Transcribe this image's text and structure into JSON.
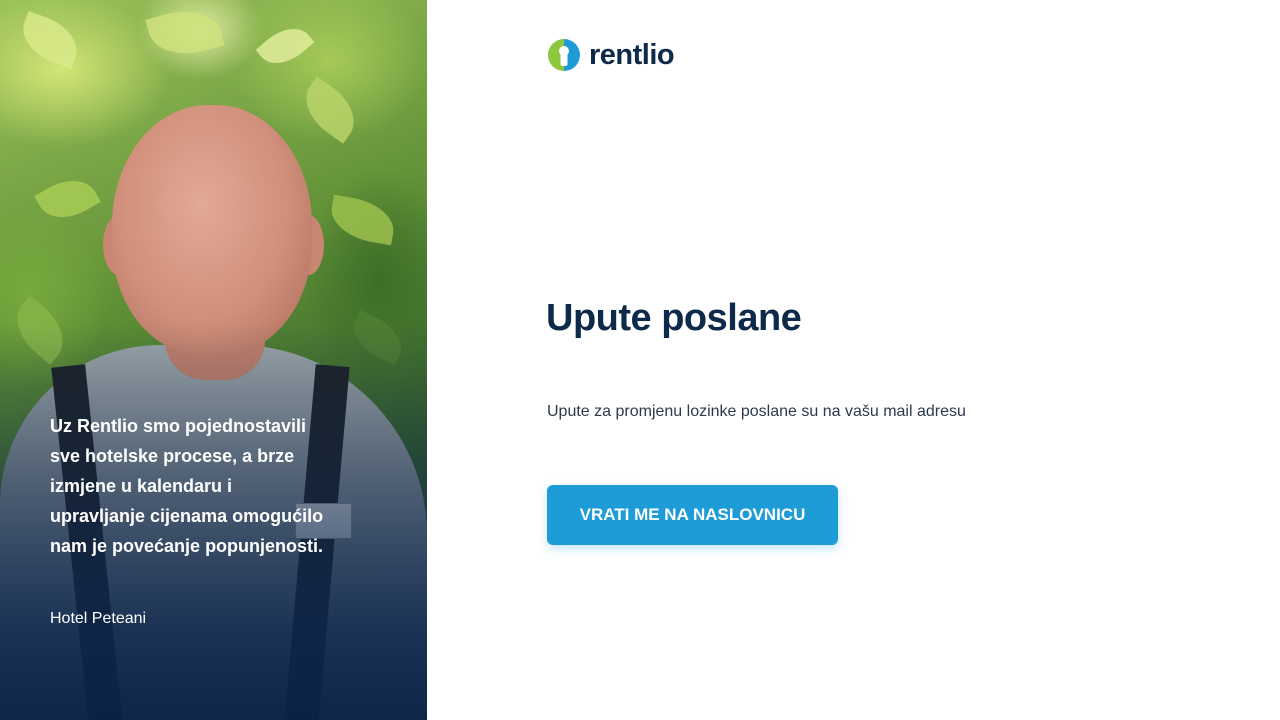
{
  "brand": {
    "name": "rentlio",
    "colors": {
      "primary_dark": "#0e2a4b",
      "accent_blue": "#1d9cd8",
      "logo_green": "#8dc63f",
      "logo_blue": "#1d9cd8"
    },
    "logo_icon": "rentlio-keyhole-icon"
  },
  "testimonial": {
    "quote": "Uz Rentlio smo pojednostavili sve hotelske procese, a brze izmjene u kalendaru i upravljanje cijenama omogućilo nam je povećanje popunjenosti.",
    "author": "Hotel Peteani"
  },
  "main": {
    "title": "Upute poslane",
    "message": "Upute za promjenu lozinke poslane su na vašu mail adresu",
    "back_button_label": "VRATI ME NA NASLOVNICU"
  }
}
